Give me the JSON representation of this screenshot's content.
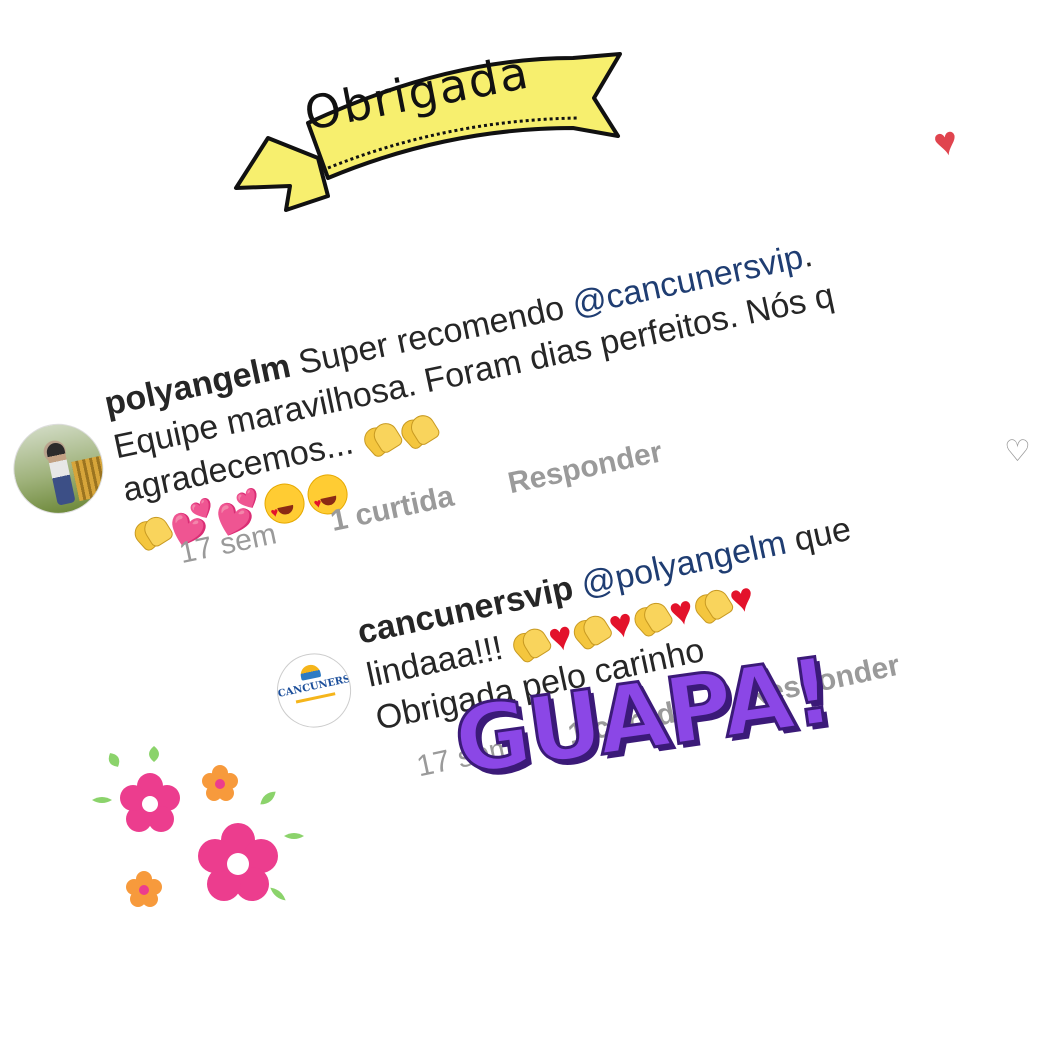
{
  "banner": {
    "text": "Obrigada"
  },
  "comments": [
    {
      "username": "polyangelm",
      "text_before": "Super recomendo",
      "mention": "@cancunersvip",
      "text_after": ". Equipe maravilhosa. Foram dias perfeitos. Nós q agradecemos...",
      "time": "17 sem",
      "likes": "1 curtida",
      "reply": "Responder",
      "liked": true
    },
    {
      "username": "cancunersvip",
      "mention": "@polyangelm",
      "text_after": " que lindaaa!!!",
      "text_line2": "Obrigada pelo carinho",
      "time": "17 sem",
      "likes": "1 curtida",
      "reply": "Responder",
      "avatar_brand": "CANCUNERS",
      "liked": false
    }
  ],
  "sticker": {
    "text": "GUAPA!"
  },
  "colors": {
    "mention": "#1f3d72",
    "like_filled": "#e0444e",
    "muted": "#9a9a9a",
    "banner": "#f7ef6e",
    "guapa": "#8b47e6"
  },
  "icons": [
    "heart-filled-icon",
    "heart-outline-icon",
    "clapping-hands-icon",
    "red-heart-icon",
    "two-hearts-icon",
    "heart-eyes-icon",
    "flower-icon"
  ]
}
